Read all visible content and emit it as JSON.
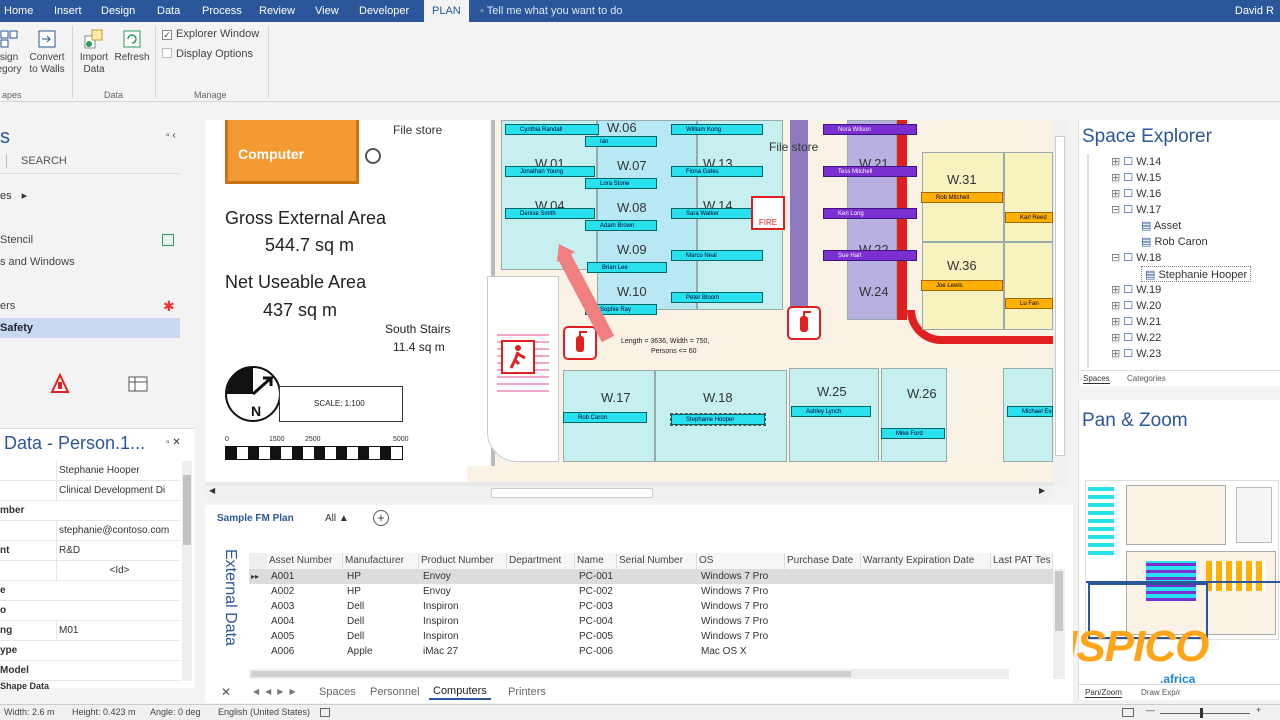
{
  "ribbon": {
    "tabs": [
      "Home",
      "Insert",
      "Design",
      "Data",
      "Process",
      "Review",
      "View",
      "Developer",
      "PLAN"
    ],
    "active_tab": "PLAN",
    "tell_me": "Tell me what you want to do",
    "user": "David R",
    "buttons": {
      "assign_category": "Assign Category",
      "assign_line1": "sign",
      "assign_line2": "egory",
      "convert_line1": "Convert",
      "convert_line2": "to Walls",
      "import_line1": "Import",
      "import_line2": "Data",
      "refresh": "Refresh"
    },
    "checkboxes": {
      "explorer_window": "Explorer Window",
      "display_options": "Display Options"
    },
    "groups": {
      "shapes": "apes",
      "data": "Data",
      "manage": "Manage"
    }
  },
  "shapes_pane": {
    "title": "s",
    "search": "SEARCH",
    "more": "es",
    "items": [
      "Stencil",
      "s and Windows",
      "",
      "ers",
      "Safety"
    ],
    "selected_index": 4
  },
  "shape_data": {
    "title": "Data - Person.1...",
    "rows": [
      {
        "k": "",
        "v": "Stephanie Hooper"
      },
      {
        "k": "",
        "v": "Clinical Development Di"
      },
      {
        "k": "mber",
        "v": ""
      },
      {
        "k": "",
        "v": "stephanie@contoso.com"
      },
      {
        "k": "nt",
        "v": "R&D"
      },
      {
        "k": "",
        "v": "<Id>"
      },
      {
        "k": "e",
        "v": ""
      },
      {
        "k": "o",
        "v": ""
      },
      {
        "k": "ng",
        "v": "M01"
      },
      {
        "k": "ype",
        "v": ""
      },
      {
        "k": "Model",
        "v": ""
      }
    ],
    "footer": "Shape Data"
  },
  "canvas": {
    "computer_btn": "Computer",
    "file_store_1": "File store",
    "file_store_2": "File store",
    "gross_label": "Gross External Area",
    "gross_value": "544.7 sq m",
    "net_label": "Net Useable Area",
    "net_value": "437 sq m",
    "stairs_label": "South Stairs",
    "stairs_value": "11.4 sq m",
    "scale_text": "SCALE: 1:100",
    "scale_ticks": [
      "0",
      "1500",
      "2500",
      "5000"
    ],
    "dimension_text_1": "Length = 3636, Width = 750,",
    "dimension_text_2": "Persons <= 60",
    "fire_label": "FIRE",
    "rooms": [
      "W.06",
      "W.07",
      "W.08",
      "W.09",
      "W.10",
      "W.01",
      "W.04",
      "W.13",
      "W.14",
      "W.17",
      "W.18",
      "W.25",
      "W.26",
      "W.31",
      "W.36",
      "W.24",
      "W.21",
      "W.22"
    ],
    "people": [
      "Cynthia Randall",
      "Ian",
      "Jonathan Young",
      "Denise Smith",
      "Lora Stone",
      "Adam Brown",
      "William Kong",
      "Fiona Gates",
      "Sara Walker",
      "Marco Neal",
      "Brian Lee",
      "Peter Bloom",
      "Rob Caron",
      "Stephanie Hooper",
      "Ashley Lynch",
      "Mike Ford",
      "Michael Evans",
      "Nora Wilson",
      "Tess Mitchell",
      "Ken Long",
      "Sue Hart",
      "Rob Mitchell",
      "Karl Reed",
      "Joe Lewis",
      "Lu Fan",
      "Sophie Ray"
    ]
  },
  "explorer": {
    "title": "Space Explorer",
    "items": [
      {
        "label": "W.14",
        "level": 0
      },
      {
        "label": "W.15",
        "level": 0
      },
      {
        "label": "W.16",
        "level": 0
      },
      {
        "label": "W.17",
        "level": 0
      },
      {
        "label": "Asset",
        "level": 1
      },
      {
        "label": "Rob Caron",
        "level": 1
      },
      {
        "label": "W.18",
        "level": 0
      },
      {
        "label": "Stephanie Hooper",
        "level": 1
      },
      {
        "label": "W.19",
        "level": 0
      },
      {
        "label": "W.20",
        "level": 0
      },
      {
        "label": "W.21",
        "level": 0
      },
      {
        "label": "W.22",
        "level": 0
      },
      {
        "label": "W.23",
        "level": 0
      }
    ],
    "tabs": [
      "Spaces",
      "Categories"
    ]
  },
  "panzoom": {
    "title": "Pan & Zoom",
    "tabs": [
      "Pan/Zoom",
      "Draw Exp/r"
    ]
  },
  "watermark": {
    "brand": "KMSPICO",
    "suffix": ".africa"
  },
  "external_data": {
    "side_title": "External Data",
    "page_name": "Sample FM Plan",
    "filter": "All",
    "columns": [
      "Asset Number",
      "Manufacturer",
      "Product Number",
      "Department",
      "Name",
      "Serial Number",
      "OS",
      "Purchase Date",
      "Warranty Expiration Date",
      "Last PAT Tes"
    ],
    "rows": [
      [
        "A001",
        "HP",
        "Envoy",
        "",
        "PC-001",
        "",
        "Windows 7 Pro"
      ],
      [
        "A002",
        "HP",
        "Envoy",
        "",
        "PC-002",
        "",
        "Windows 7 Pro"
      ],
      [
        "A003",
        "Dell",
        "Inspiron",
        "",
        "PC-003",
        "",
        "Windows 7 Pro"
      ],
      [
        "A004",
        "Dell",
        "Inspiron",
        "",
        "PC-004",
        "",
        "Windows 7 Pro"
      ],
      [
        "A005",
        "Dell",
        "Inspiron",
        "",
        "PC-005",
        "",
        "Windows 7 Pro"
      ],
      [
        "A006",
        "Apple",
        "iMac 27",
        "",
        "PC-006",
        "",
        "Mac OS X"
      ]
    ],
    "sheet_tabs": [
      "Spaces",
      "Personnel",
      "Computers",
      "Printers"
    ],
    "active_sheet": "Computers"
  },
  "status": {
    "width": "Width: 2.6 m",
    "height": "Height: 0.423 m",
    "angle": "Angle: 0 deg",
    "language": "English (United States)"
  },
  "colors": {
    "accent": "#2b579a",
    "cyan": "#29e0ee",
    "purple": "#7b2fd1",
    "orange": "#ffb000",
    "fire_red": "#e02020"
  }
}
